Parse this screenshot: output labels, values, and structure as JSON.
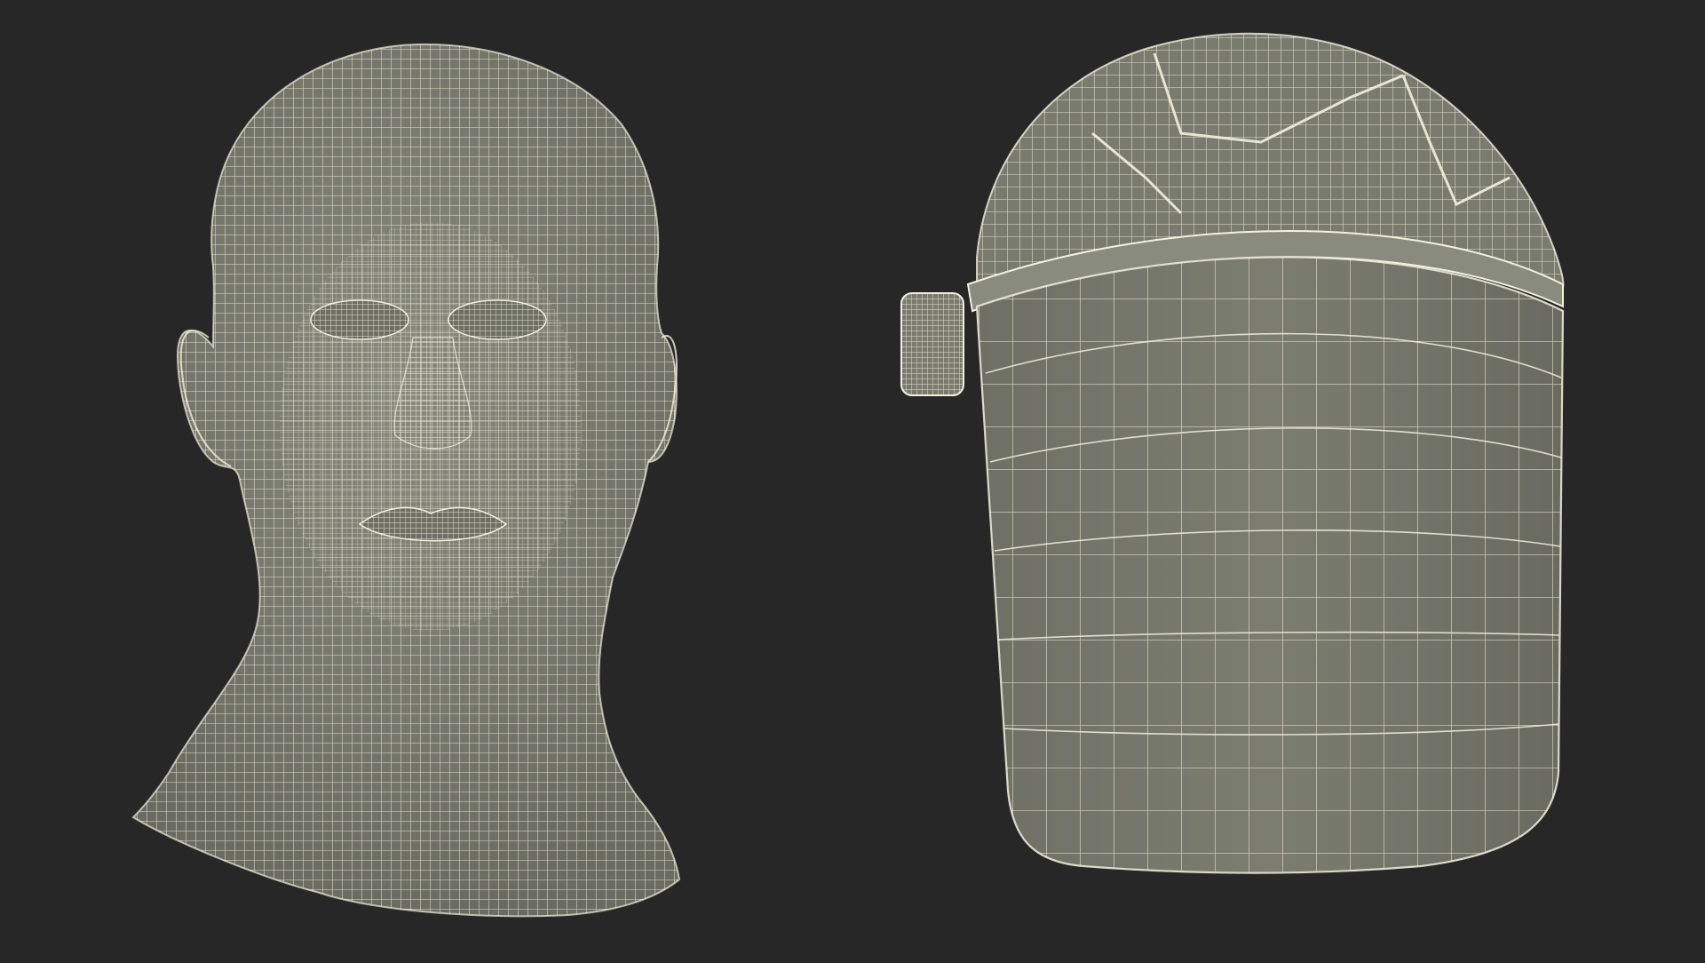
{
  "scene": {
    "background_color": "#272727",
    "mesh_fill_color": "#7a7b6f",
    "mesh_fill_shade": "#6a6b60",
    "wire_color": "#f2f1df",
    "render_mode": "wireframe-on-shaded"
  },
  "models": [
    {
      "name": "human-head",
      "view": "front"
    },
    {
      "name": "face-shield",
      "view": "front"
    }
  ]
}
